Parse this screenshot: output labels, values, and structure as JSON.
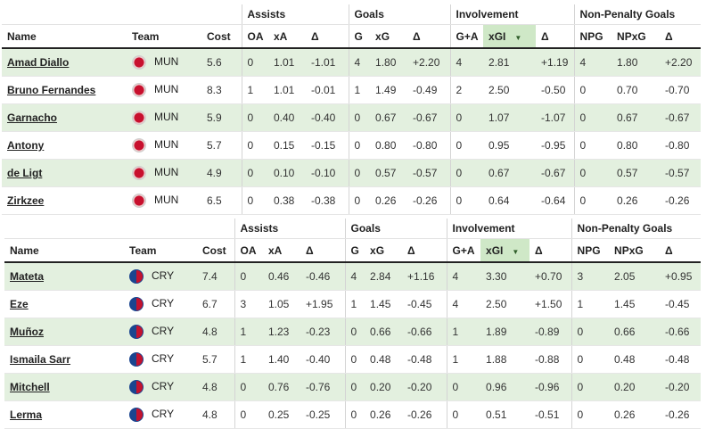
{
  "columns": {
    "groups": {
      "assists": "Assists",
      "goals": "Goals",
      "involvement": "Involvement",
      "npg": "Non-Penalty Goals"
    },
    "name": "Name",
    "team": "Team",
    "cost": "Cost",
    "oa": "OA",
    "xa": "xA",
    "delta": "Δ",
    "g": "G",
    "xg": "xG",
    "ga": "G+A",
    "xgi": "xGI",
    "npg": "NPG",
    "npxg": "NPxG"
  },
  "sort_icon": "triangle-down-icon",
  "colors": {
    "row_highlight": "#e3f0df",
    "sorted_header": "#cfe8c7",
    "mun_red": "#c8102e",
    "cry_blue": "#1b458f",
    "cry_red": "#c4122e"
  },
  "tables": [
    {
      "rows": [
        {
          "name": "Amad Diallo",
          "team": "MUN",
          "cost": "5.6",
          "oa": "0",
          "xa": "1.01",
          "ad": "-1.01",
          "g": "4",
          "xg": "1.80",
          "gd": "+2.20",
          "ga": "4",
          "xgi": "2.81",
          "id": "+1.19",
          "npg": "4",
          "npxg": "1.80",
          "nd": "+2.20"
        },
        {
          "name": "Bruno Fernandes",
          "team": "MUN",
          "cost": "8.3",
          "oa": "1",
          "xa": "1.01",
          "ad": "-0.01",
          "g": "1",
          "xg": "1.49",
          "gd": "-0.49",
          "ga": "2",
          "xgi": "2.50",
          "id": "-0.50",
          "npg": "0",
          "npxg": "0.70",
          "nd": "-0.70"
        },
        {
          "name": "Garnacho",
          "team": "MUN",
          "cost": "5.9",
          "oa": "0",
          "xa": "0.40",
          "ad": "-0.40",
          "g": "0",
          "xg": "0.67",
          "gd": "-0.67",
          "ga": "0",
          "xgi": "1.07",
          "id": "-1.07",
          "npg": "0",
          "npxg": "0.67",
          "nd": "-0.67"
        },
        {
          "name": "Antony",
          "team": "MUN",
          "cost": "5.7",
          "oa": "0",
          "xa": "0.15",
          "ad": "-0.15",
          "g": "0",
          "xg": "0.80",
          "gd": "-0.80",
          "ga": "0",
          "xgi": "0.95",
          "id": "-0.95",
          "npg": "0",
          "npxg": "0.80",
          "nd": "-0.80"
        },
        {
          "name": "de Ligt",
          "team": "MUN",
          "cost": "4.9",
          "oa": "0",
          "xa": "0.10",
          "ad": "-0.10",
          "g": "0",
          "xg": "0.57",
          "gd": "-0.57",
          "ga": "0",
          "xgi": "0.67",
          "id": "-0.67",
          "npg": "0",
          "npxg": "0.57",
          "nd": "-0.57"
        },
        {
          "name": "Zirkzee",
          "team": "MUN",
          "cost": "6.5",
          "oa": "0",
          "xa": "0.38",
          "ad": "-0.38",
          "g": "0",
          "xg": "0.26",
          "gd": "-0.26",
          "ga": "0",
          "xgi": "0.64",
          "id": "-0.64",
          "npg": "0",
          "npxg": "0.26",
          "nd": "-0.26"
        }
      ]
    },
    {
      "rows": [
        {
          "name": "Mateta",
          "team": "CRY",
          "cost": "7.4",
          "oa": "0",
          "xa": "0.46",
          "ad": "-0.46",
          "g": "4",
          "xg": "2.84",
          "gd": "+1.16",
          "ga": "4",
          "xgi": "3.30",
          "id": "+0.70",
          "npg": "3",
          "npxg": "2.05",
          "nd": "+0.95"
        },
        {
          "name": "Eze",
          "team": "CRY",
          "cost": "6.7",
          "oa": "3",
          "xa": "1.05",
          "ad": "+1.95",
          "g": "1",
          "xg": "1.45",
          "gd": "-0.45",
          "ga": "4",
          "xgi": "2.50",
          "id": "+1.50",
          "npg": "1",
          "npxg": "1.45",
          "nd": "-0.45"
        },
        {
          "name": "Muñoz",
          "team": "CRY",
          "cost": "4.8",
          "oa": "1",
          "xa": "1.23",
          "ad": "-0.23",
          "g": "0",
          "xg": "0.66",
          "gd": "-0.66",
          "ga": "1",
          "xgi": "1.89",
          "id": "-0.89",
          "npg": "0",
          "npxg": "0.66",
          "nd": "-0.66"
        },
        {
          "name": "Ismaila Sarr",
          "team": "CRY",
          "cost": "5.7",
          "oa": "1",
          "xa": "1.40",
          "ad": "-0.40",
          "g": "0",
          "xg": "0.48",
          "gd": "-0.48",
          "ga": "1",
          "xgi": "1.88",
          "id": "-0.88",
          "npg": "0",
          "npxg": "0.48",
          "nd": "-0.48"
        },
        {
          "name": "Mitchell",
          "team": "CRY",
          "cost": "4.8",
          "oa": "0",
          "xa": "0.76",
          "ad": "-0.76",
          "g": "0",
          "xg": "0.20",
          "gd": "-0.20",
          "ga": "0",
          "xgi": "0.96",
          "id": "-0.96",
          "npg": "0",
          "npxg": "0.20",
          "nd": "-0.20"
        },
        {
          "name": "Lerma",
          "team": "CRY",
          "cost": "4.8",
          "oa": "0",
          "xa": "0.25",
          "ad": "-0.25",
          "g": "0",
          "xg": "0.26",
          "gd": "-0.26",
          "ga": "0",
          "xgi": "0.51",
          "id": "-0.51",
          "npg": "0",
          "npxg": "0.26",
          "nd": "-0.26"
        }
      ]
    }
  ]
}
